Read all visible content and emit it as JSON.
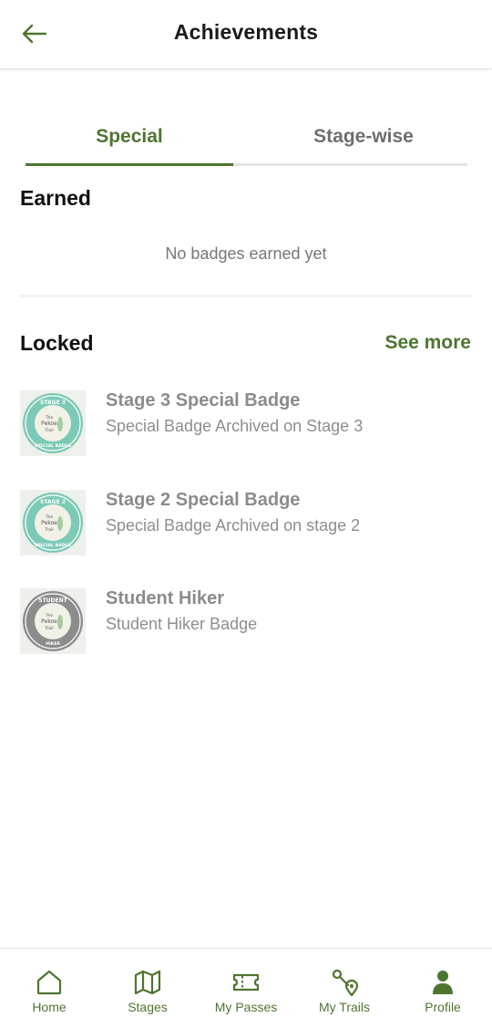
{
  "header": {
    "title": "Achievements",
    "back_icon": "arrow-left-icon"
  },
  "tabs": [
    {
      "label": "Special",
      "active": true
    },
    {
      "label": "Stage-wise",
      "active": false
    }
  ],
  "earned": {
    "title": "Earned",
    "empty_text": "No badges earned yet"
  },
  "locked": {
    "title": "Locked",
    "see_more": "See more",
    "items": [
      {
        "title": "Stage 3 Special Badge",
        "subtitle": "Special Badge Archived on Stage 3",
        "badge_ring_text": "STAGE 3",
        "badge_bottom_text": "SPECIAL BADGE",
        "badge_color": "#7cc9b6"
      },
      {
        "title": "Stage 2 Special Badge",
        "subtitle": "Special Badge Archived on stage 2",
        "badge_ring_text": "STAGE 2",
        "badge_bottom_text": "SPECIAL BADGE",
        "badge_color": "#7cc9b6"
      },
      {
        "title": "Student Hiker",
        "subtitle": "Student Hiker Badge",
        "badge_ring_text": "STUDENT",
        "badge_bottom_text": "HIKER",
        "badge_color": "#8c8c8c"
      }
    ],
    "badge_center": [
      "The",
      "Pekoe",
      "Trail"
    ]
  },
  "nav": [
    {
      "label": "Home",
      "icon": "home-icon"
    },
    {
      "label": "Stages",
      "icon": "map-icon"
    },
    {
      "label": "My Passes",
      "icon": "ticket-icon"
    },
    {
      "label": "My Trails",
      "icon": "route-icon"
    },
    {
      "label": "Profile",
      "icon": "user-icon"
    }
  ],
  "colors": {
    "accent": "#4e7530",
    "muted_text": "#8b8b8b"
  }
}
